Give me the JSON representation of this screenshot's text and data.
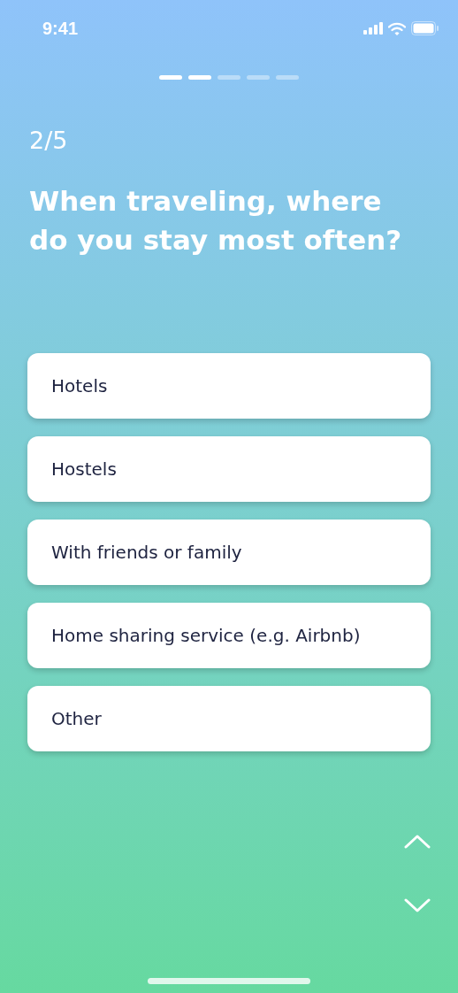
{
  "status_bar": {
    "time": "9:41"
  },
  "progress": [
    {
      "done": true
    },
    {
      "done": true
    },
    {
      "done": false
    },
    {
      "done": false
    },
    {
      "done": false
    }
  ],
  "counter": "2/5",
  "question": "When traveling, where do you stay most often?",
  "options": [
    {
      "label": "Hotels"
    },
    {
      "label": "Hostels"
    },
    {
      "label": "With friends or family"
    },
    {
      "label": "Home sharing service (e.g. Airbnb)"
    },
    {
      "label": "Other"
    }
  ]
}
